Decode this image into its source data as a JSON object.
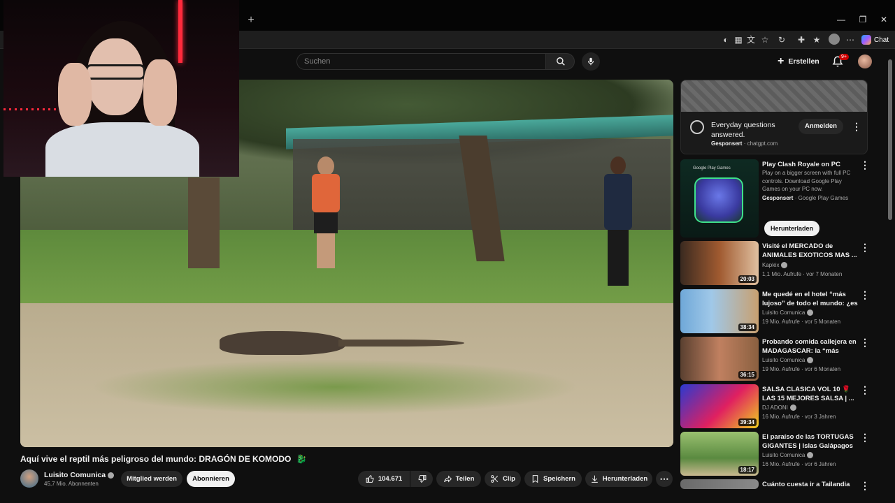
{
  "browser": {
    "new_tab_glyph": "+",
    "window_controls": [
      "—",
      "❐",
      "✕"
    ],
    "chat_label": "Chat"
  },
  "header": {
    "search_placeholder": "Suchen",
    "create_label": "Erstellen",
    "notification_badge": "9+"
  },
  "video": {
    "title": "Aquí vive el reptil más peligroso del mundo: DRAGÓN DE KOMODO",
    "title_emoji": "🐉",
    "channel": "Luisito Comunica",
    "subscribers": "45,7 Mio. Abonnenten",
    "member_button": "Mitglied werden",
    "subscribe_button": "Abonnieren",
    "likes": "104.671",
    "share_label": "Teilen",
    "clip_label": "Clip",
    "save_label": "Speichern",
    "download_label": "Herunterladen"
  },
  "ad": {
    "title": "Everyday questions answered.",
    "sponsored": "Gesponsert",
    "domain": "chatgpt.com",
    "cta": "Anmelden"
  },
  "sponsored_rec": {
    "title": "Play Clash Royale on PC",
    "brand_label": "Google Play Games",
    "description": "Play on a bigger screen with full PC controls. Download Google Play Games on your PC now.",
    "sponsored": "Gesponsert",
    "advertiser": "Google Play Games",
    "cta": "Herunterladen"
  },
  "recommendations": [
    {
      "title": "Visité el MERCADO de ANIMALES EXOTICOS MAS ...",
      "channel": "Kapléx",
      "meta": "1,1 Mio. Aufrufe · vor 7 Monaten",
      "duration": "20:03"
    },
    {
      "title": "Me quedé en el hotel “más lujoso” de todo el mundo: ¿es ...",
      "channel": "Luisito Comunica",
      "meta": "19 Mio. Aufrufe · vor 5 Monaten",
      "duration": "38:34"
    },
    {
      "title": "Probando comida callejera en MADAGASCAR: la “más barata...",
      "channel": "Luisito Comunica",
      "meta": "19 Mio. Aufrufe · vor 6 Monaten",
      "duration": "36:15"
    },
    {
      "title": "SALSA CLASICA VOL 10 🌹 LAS 15 MEJORES SALSA | ...",
      "channel": "DJ ADONI",
      "meta": "16 Mio. Aufrufe · vor 3 Jahren",
      "duration": "39:34"
    },
    {
      "title": "El paraíso de las TORTUGAS GIGANTES | Islas Galápagos 🐢",
      "channel": "Luisito Comunica",
      "meta": "16 Mio. Aufrufe · vor 6 Jahren",
      "duration": "18:17"
    },
    {
      "title": "Cuánto cuesta ir a Tailandia",
      "channel": "",
      "meta": "",
      "duration": ""
    }
  ],
  "colors": {
    "background": "#0f0f0f",
    "text": "#f1f1f1",
    "secondary_text": "#aaaaaa",
    "pill": "#272727",
    "accent_red": "#cc0000"
  }
}
